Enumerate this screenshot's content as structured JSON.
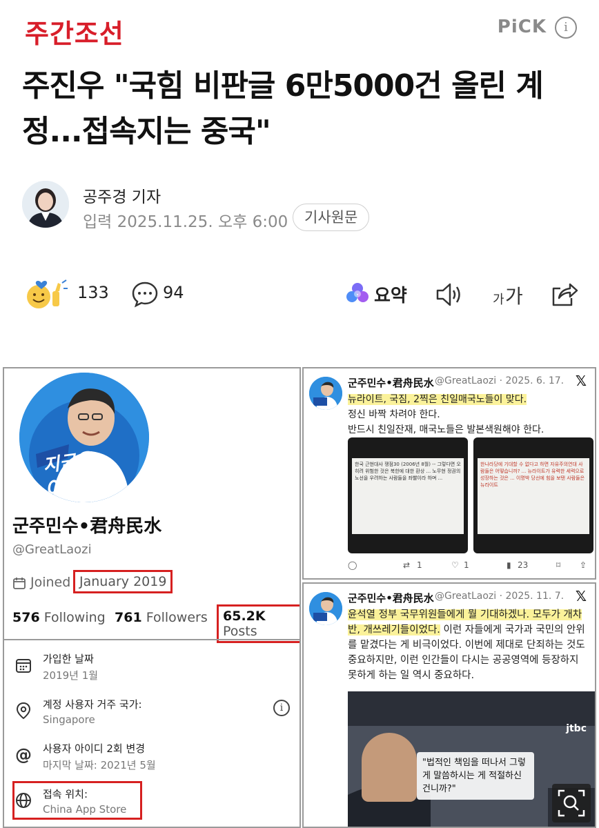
{
  "header": {
    "logo": "주간조선",
    "pick_label": "PiCK",
    "info_glyph": "i"
  },
  "article": {
    "headline": "주진우 \"국힘 비판글 6만5000건 올린 계정...접속지는 중국\"",
    "author": "공주경 기자",
    "published": "입력 2025.11.25. 오후 6:00",
    "original_button": "기사원문"
  },
  "actions": {
    "reaction_count": "133",
    "comment_count": "94",
    "summary_label": "요약",
    "font_small": "가",
    "font_big": "가"
  },
  "profile": {
    "avatar_text_top": "지금은",
    "avatar_text_bottom": "이재명",
    "name": "군주민수•君舟民水",
    "handle": "@GreatLaozi",
    "joined_label": "Joined",
    "joined_date": "January 2019",
    "following_num": "576",
    "following_label": "Following",
    "followers_num": "761",
    "followers_label": "Followers",
    "posts_num": "65.2K",
    "posts_label": "Posts",
    "about": [
      {
        "title": "가입한 날짜",
        "value": "2019년 1월"
      },
      {
        "title": "계정 사용자 거주 국가:",
        "value": "Singapore"
      },
      {
        "title": "사용자 아이디 2회 변경",
        "value": "마지막 날짜: 2021년 5월"
      },
      {
        "title": "접속 위치:",
        "value": "China App Store"
      }
    ]
  },
  "tweets": [
    {
      "name": "군주민수•君舟民水",
      "meta": "@GreatLaozi · 2025. 6. 17.",
      "line1": "뉴라이트, 국짐, 2찍은 친일매국노들이 맞다.",
      "line2": "정신 바짝 차려야 한다.",
      "line3": "반드시 친일잔재, 매국노들은 발본색원해야 한다.",
      "img1_text": "한국 근현대사 쟁점30 (2006년 8월) -- 그렇다면 오히려 위험한 것은 북한에 대한 환상 ... 노무현 정권의 노선을 우려하는 사람들을 좌빨이라 하며 ...",
      "img2_text": "한나라당에 기대할 수 없다고 하면 자유주의연대 사람들은 어떻습니까? ... 뉴라이트가 유력한 세력으로 성장하는 것은 ... 이명박 당선에 힘을 보탠 사람들은 뉴라이트",
      "reply": "",
      "retweet": "1",
      "like": "1",
      "views": "23"
    },
    {
      "name": "군주민수•君舟民水",
      "meta": "@GreatLaozi · 2025. 11. 7.",
      "hl1": "윤석열 정부 국무위원들에게 뭘 기대하겠나. 모두가 개차반, 개쓰레기들이었다.",
      "rest": "이런 자들에게 국가과 국민의 안위를 맡겼다는 게 비극이었다. 이번에 제대로 단죄하는 것도 중요하지만, 이런 인간들이 다시는 공공영역에 등장하지 못하게 하는 일 역시 중요하다.",
      "video_caption": "\"법적인 책임을 떠나서 그렇게 말씀하시는 게 적절하신 건니까?\"",
      "channel": "jtbc"
    }
  ],
  "colors": {
    "brand": "#d81e2a",
    "highlight_box": "#d62020",
    "highlight_text": "#fbf29a"
  }
}
